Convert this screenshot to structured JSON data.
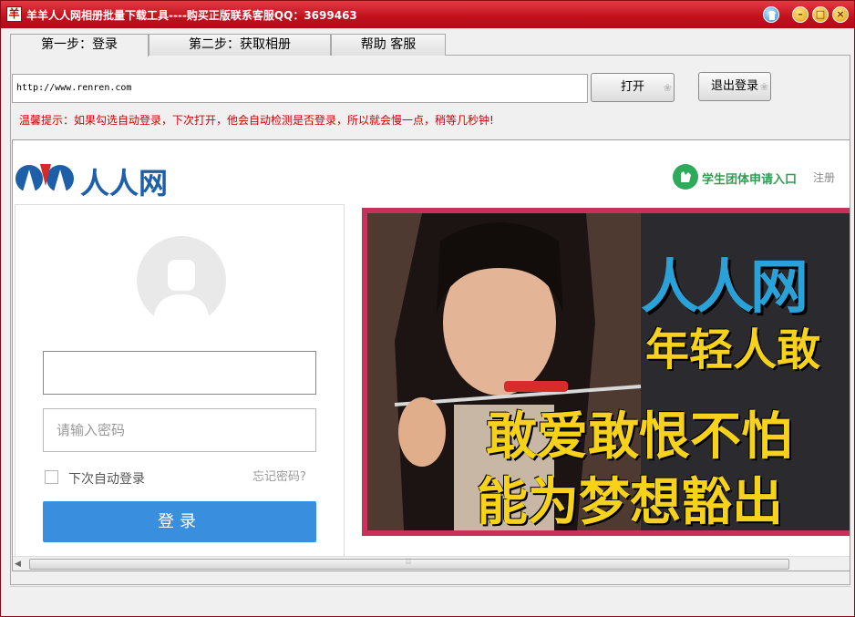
{
  "window": {
    "app_icon": "羊",
    "title": "羊羊人人网相册批量下载工具----购买正版联系客服QQ：3699463"
  },
  "tabs": [
    {
      "label": "第一步：登录"
    },
    {
      "label": "第二步：获取相册"
    },
    {
      "label": "帮助 客服"
    }
  ],
  "toolbar": {
    "url_value": "http://www.renren.com",
    "open_label": "打开",
    "logout_label": "退出登录",
    "tip": "温馨提示：如果勾选自动登录，下次打开，他会自动检测是否登录，所以就会慢一点，稍等几秒钟!"
  },
  "site": {
    "logo_text": "人人网",
    "student_link": "学生团体申请入口",
    "register": "注册",
    "password_placeholder": "请输入密码",
    "auto_login_label": "下次自动登录",
    "forgot_password": "忘记密码?",
    "login_label": "登录",
    "banner_text_1": "人人网",
    "banner_text_2": "年轻人敢",
    "banner_text_3": "敢爱敢恨不怕",
    "banner_text_4": "能为梦想豁出"
  },
  "colors": {
    "titlebar": "#c2101d",
    "tip_red": "#d40000",
    "login_blue": "#3a8ede",
    "logo_blue": "#1d5fa8",
    "student_green": "#2e9e52"
  },
  "icons": {
    "skin": "skin-icon",
    "minimize": "minimize-icon",
    "maximize": "maximize-icon",
    "close": "close-icon"
  }
}
